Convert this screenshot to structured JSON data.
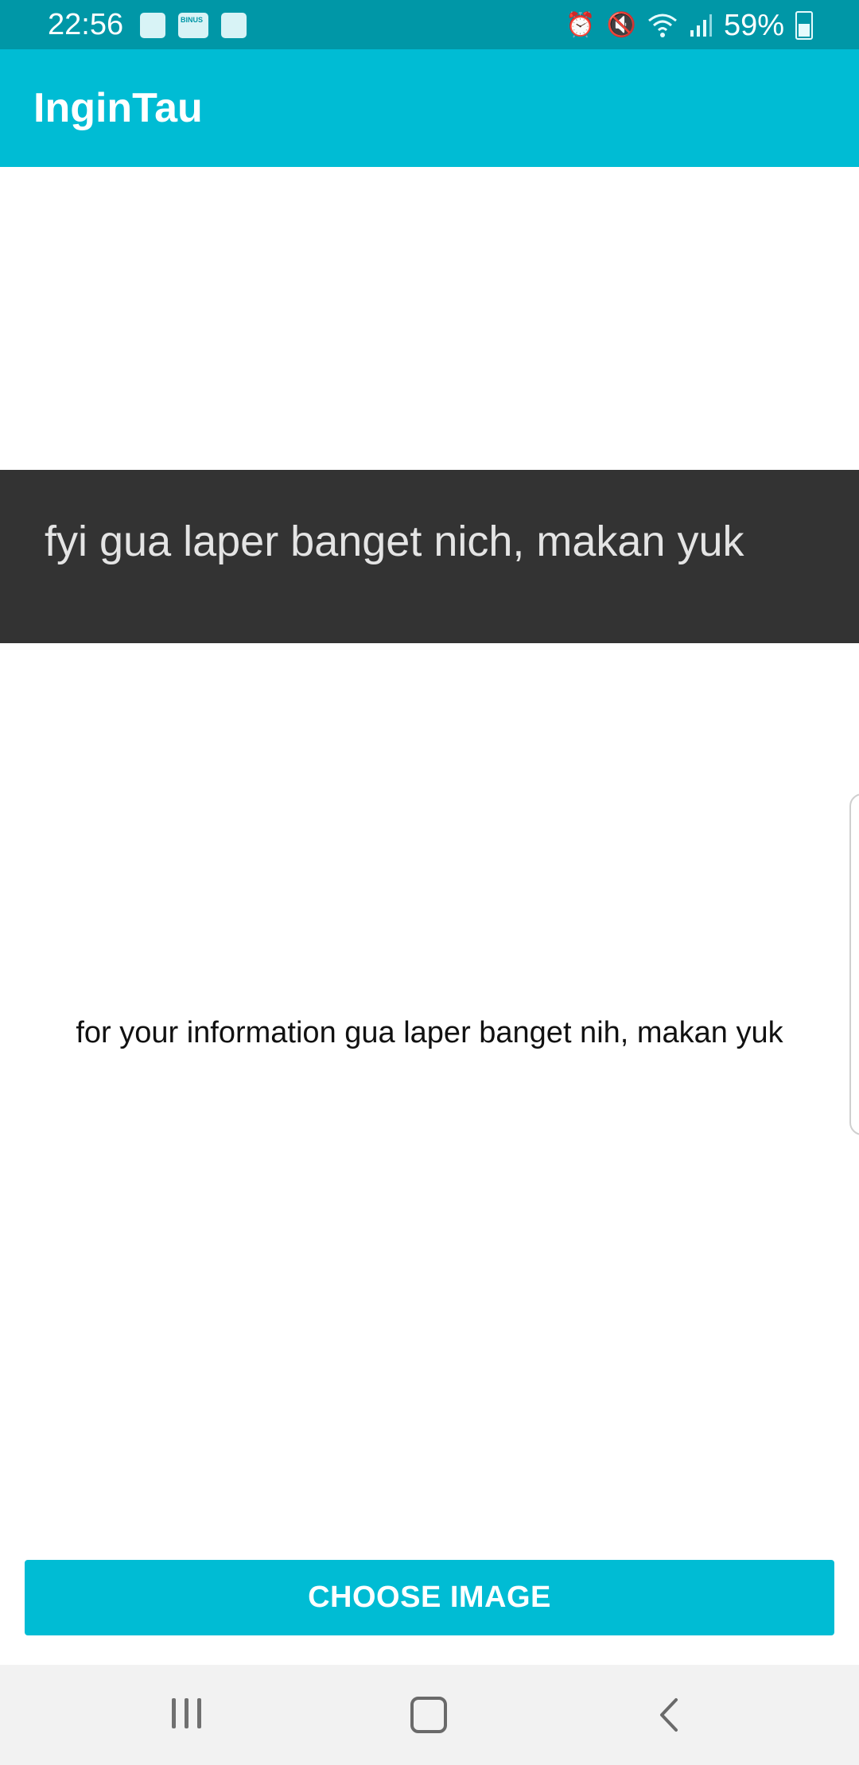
{
  "status_bar": {
    "time": "22:56",
    "battery": "59%",
    "left_icons": [
      "image-icon",
      "binus-mobile-icon",
      "phone-icon"
    ],
    "right_icons": [
      "alarm-icon",
      "mute-icon",
      "wifi-icon",
      "signal-icon",
      "battery-icon"
    ]
  },
  "app_bar": {
    "title": "InginTau"
  },
  "image_preview": {
    "text": "fyi gua laper banget nich, makan yuk"
  },
  "result": {
    "text": "for your information gua laper banget nih, makan yuk"
  },
  "actions": {
    "choose_image_label": "CHOOSE IMAGE"
  },
  "colors": {
    "primary": "#00bcd4",
    "primary_dark": "#0097a7",
    "image_bg": "#333333"
  }
}
